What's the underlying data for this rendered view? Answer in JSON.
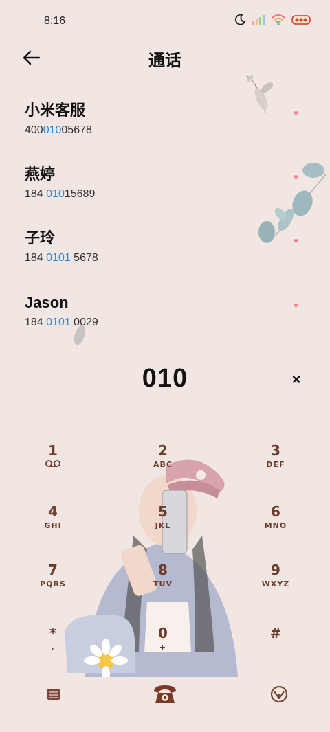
{
  "status": {
    "time": "8:16",
    "battery": "battery"
  },
  "header": {
    "title": "通话"
  },
  "contacts": [
    {
      "name": "小米客服",
      "num_pre": "400",
      "num_hl": "010",
      "num_post": "05678"
    },
    {
      "name": "燕婷",
      "num_pre": "184 ",
      "num_hl": "010",
      "num_post": "15689"
    },
    {
      "name": "子玲",
      "num_pre": "184 ",
      "num_hl": "0101",
      "num_post": " 5678"
    },
    {
      "name": "Jason",
      "num_pre": "184 ",
      "num_hl": "0101",
      "num_post": " 0029"
    }
  ],
  "dialer": {
    "display": "010",
    "clear": "×"
  },
  "keys": [
    {
      "digit": "1",
      "letters": ""
    },
    {
      "digit": "2",
      "letters": "ABC"
    },
    {
      "digit": "3",
      "letters": "DEF"
    },
    {
      "digit": "4",
      "letters": "GHI"
    },
    {
      "digit": "5",
      "letters": "JKL"
    },
    {
      "digit": "6",
      "letters": "MNO"
    },
    {
      "digit": "7",
      "letters": "PQRS"
    },
    {
      "digit": "8",
      "letters": "TUV"
    },
    {
      "digit": "9",
      "letters": "WXYZ"
    },
    {
      "digit": "*",
      "letters": ","
    },
    {
      "digit": "0",
      "letters": "+"
    },
    {
      "digit": "#",
      "letters": ""
    }
  ],
  "icons": {
    "back": "back-arrow-icon",
    "heart": "♥",
    "voicemail": "voicemail-icon",
    "keypad_toggle": "keypad-toggle-icon",
    "call": "phone-call-icon",
    "menu": "menu-icon"
  },
  "colors": {
    "background": "#f2e6e2",
    "highlight": "#2a88d8",
    "key_text": "#6b3c2c",
    "heart": "#e88888"
  }
}
